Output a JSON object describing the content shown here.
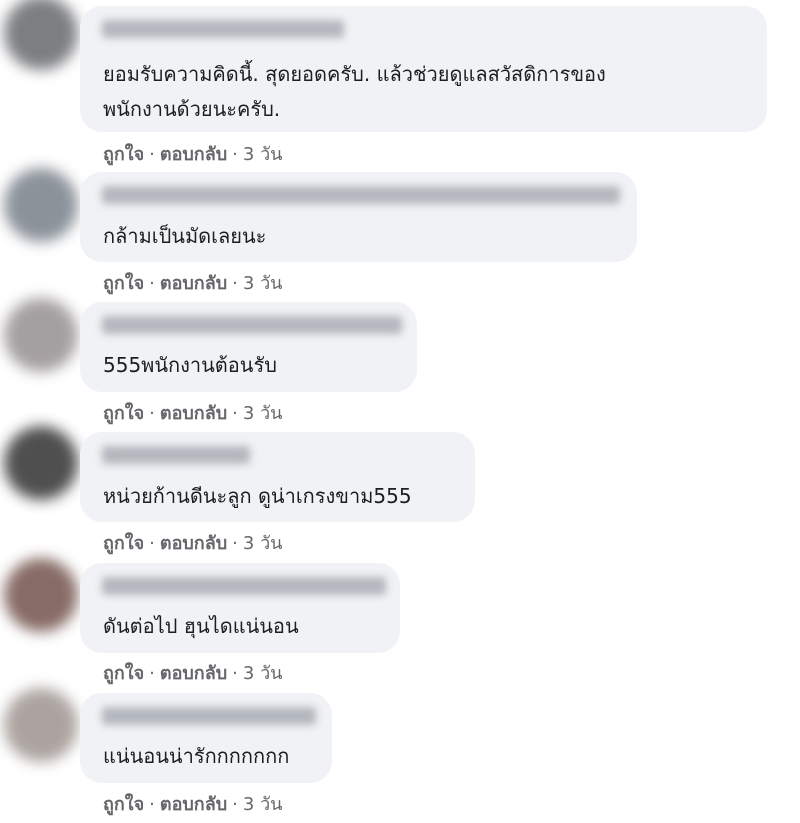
{
  "comments": [
    {
      "text_lines": [
        "ยอมรับความคิดนี้. สุดยอดครับ. แล้วช่วยดูแลสวัสดิการของ",
        "พนักงานด้วยนะครับ."
      ],
      "like": "ถูกใจ",
      "reply": "ตอบกลับ",
      "time": "3 วัน",
      "avatar_color": "#6f7175"
    },
    {
      "text_lines": [
        "กล้ามเป็นมัดเลยนะ"
      ],
      "like": "ถูกใจ",
      "reply": "ตอบกลับ",
      "time": "3 วัน",
      "avatar_color": "#7f8790"
    },
    {
      "text_lines": [
        "555พนักงานต้อนรับ"
      ],
      "like": "ถูกใจ",
      "reply": "ตอบกลับ",
      "time": "3 วัน",
      "avatar_color": "#9b9597"
    },
    {
      "text_lines": [
        "หน่วยก้านดีนะลูก ดูน่าเกรงขาม555"
      ],
      "like": "ถูกใจ",
      "reply": "ตอบกลับ",
      "time": "3 วัน",
      "avatar_color": "#3c3c3c"
    },
    {
      "text_lines": [
        "ดันต่อไป ฮุนไดแน่นอน"
      ],
      "like": "ถูกใจ",
      "reply": "ตอบกลับ",
      "time": "3 วัน",
      "avatar_color": "#7a5c56"
    },
    {
      "text_lines": [
        "แน่นอนน่ารักกกกกกก"
      ],
      "like": "ถูกใจ",
      "reply": "ตอบกลับ",
      "time": "3 วัน",
      "avatar_color": "#a39a95"
    }
  ],
  "separator": "·"
}
